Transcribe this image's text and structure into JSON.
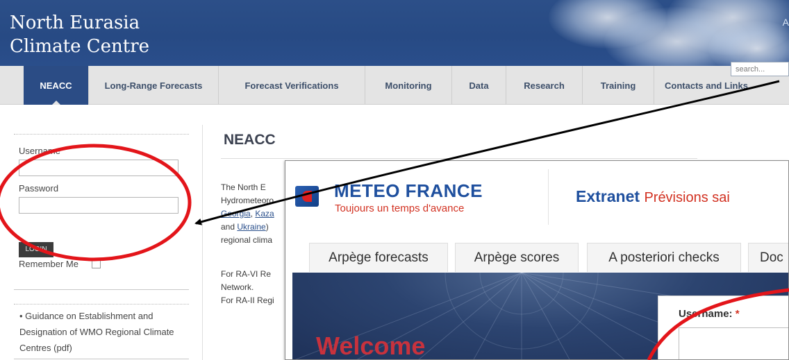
{
  "header": {
    "site_title_line1": "North Eurasia",
    "site_title_line2": "Climate Centre",
    "corner_letter": "A",
    "search_placeholder": "search..."
  },
  "nav": {
    "items": [
      {
        "label": "NEACC",
        "active": true
      },
      {
        "label": "Long-Range Forecasts",
        "active": false
      },
      {
        "label": "Forecast Verifications",
        "active": false
      },
      {
        "label": "Monitoring",
        "active": false
      },
      {
        "label": "Data",
        "active": false
      },
      {
        "label": "Research",
        "active": false
      },
      {
        "label": "Training",
        "active": false
      },
      {
        "label": "Contacts and Links",
        "active": false
      }
    ]
  },
  "login": {
    "username_label": "Username",
    "password_label": "Password",
    "remember_label": "Remember Me",
    "login_button": "LOGIN"
  },
  "sidebar_links": [
    {
      "line1": "• Guidance on Establishment and",
      "line2": "Designation of WMO Regional Climate",
      "line3": "Centres (pdf)"
    }
  ],
  "main": {
    "title": "NEACC",
    "para1": {
      "line1": "The North E",
      "line2": "Hydrometeoro",
      "line3_links": [
        "Georgia",
        "Kaza"
      ],
      "line3_sep": ", ",
      "line4_pre": "and ",
      "line4_link": "Ukraine",
      "line4_post": ")",
      "line5": "regional clima"
    },
    "para2": {
      "line1": "For RA-VI Re",
      "line2": "Network.",
      "line3": "For RA-II Regi"
    }
  },
  "overlay": {
    "brand": "METEO FRANCE",
    "tagline": "Toujours un temps d'avance",
    "extranet_bold": "Extranet",
    "extranet_rest": "Prévisions sai",
    "tabs": [
      "Arpège forecasts",
      "Arpège scores",
      "A posteriori checks",
      "Doc"
    ],
    "welcome": "Welcome",
    "username_label": "Username:",
    "required_mark": "*"
  },
  "colors": {
    "header_blue": "#2c4f88",
    "nav_active": "#2b4c85",
    "meteo_blue": "#1e4f9e",
    "meteo_red": "#d23121",
    "annotation_red": "#e3151a"
  }
}
